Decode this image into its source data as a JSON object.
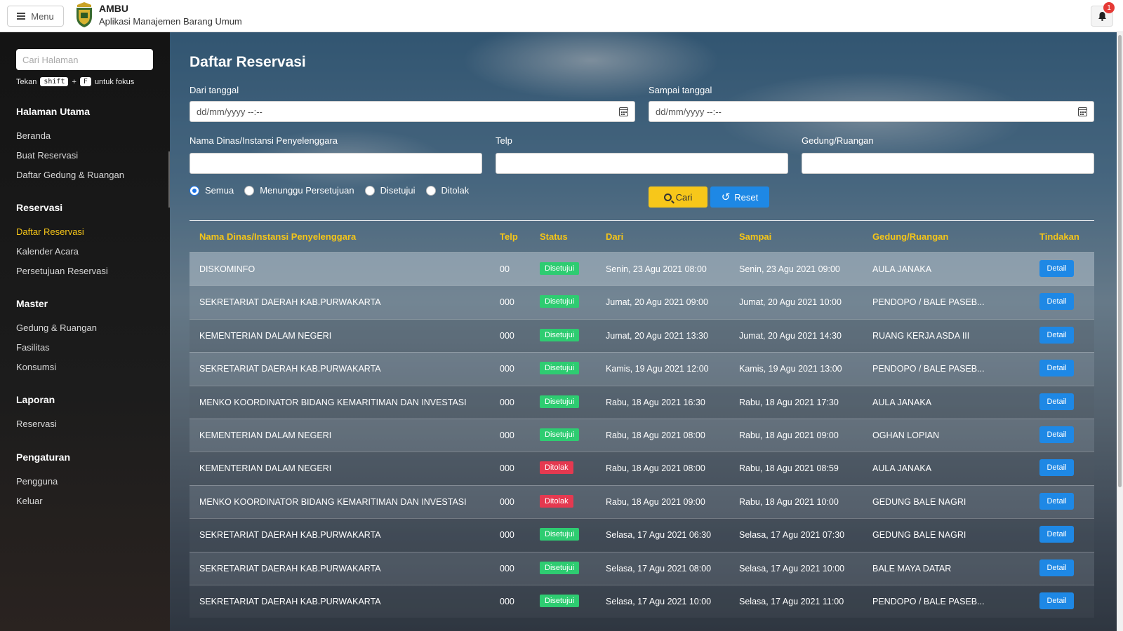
{
  "header": {
    "menu_label": "Menu",
    "app_name": "AMBU",
    "app_subtitle": "Aplikasi Manajemen Barang Umum",
    "notification_count": "1"
  },
  "sidebar": {
    "search_placeholder": "Cari Halaman",
    "hint_prefix": "Tekan",
    "hint_key1": "shift",
    "hint_plus": "+",
    "hint_key2": "F",
    "hint_suffix": "untuk fokus",
    "sections": [
      {
        "heading": "Halaman Utama",
        "items": [
          "Beranda",
          "Buat Reservasi",
          "Daftar Gedung & Ruangan"
        ]
      },
      {
        "heading": "Reservasi",
        "items": [
          "Daftar Reservasi",
          "Kalender Acara",
          "Persetujuan Reservasi"
        ]
      },
      {
        "heading": "Master",
        "items": [
          "Gedung & Ruangan",
          "Fasilitas",
          "Konsumsi"
        ]
      },
      {
        "heading": "Laporan",
        "items": [
          "Reservasi"
        ]
      },
      {
        "heading": "Pengaturan",
        "items": [
          "Pengguna",
          "Keluar"
        ]
      }
    ],
    "active_item": "Daftar Reservasi"
  },
  "main": {
    "title": "Daftar Reservasi",
    "filters": {
      "from_label": "Dari tanggal",
      "from_placeholder": "dd/mm/yyyy --:--",
      "to_label": "Sampai tanggal",
      "to_placeholder": "dd/mm/yyyy --:--",
      "org_label": "Nama Dinas/Instansi Penyelenggara",
      "phone_label": "Telp",
      "room_label": "Gedung/Ruangan",
      "radios": [
        {
          "label": "Semua",
          "checked": true
        },
        {
          "label": "Menunggu Persetujuan",
          "checked": false
        },
        {
          "label": "Disetujui",
          "checked": false
        },
        {
          "label": "Ditolak",
          "checked": false
        }
      ],
      "search_button": "Cari",
      "reset_button": "Reset"
    },
    "table": {
      "columns": [
        "Nama Dinas/Instansi Penyelenggara",
        "Telp",
        "Status",
        "Dari",
        "Sampai",
        "Gedung/Ruangan",
        "Tindakan"
      ],
      "action_label": "Detail",
      "rows": [
        {
          "org": "DISKOMINFO",
          "telp": "00",
          "status": "Disetujui",
          "from": "Senin, 23 Agu 2021 08:00",
          "to": "Senin, 23 Agu 2021 09:00",
          "room": "AULA JANAKA"
        },
        {
          "org": "SEKRETARIAT DAERAH KAB.PURWAKARTA",
          "telp": "000",
          "status": "Disetujui",
          "from": "Jumat, 20 Agu 2021 09:00",
          "to": "Jumat, 20 Agu 2021 10:00",
          "room": "PENDOPO / BALE PASEB..."
        },
        {
          "org": "KEMENTERIAN DALAM NEGERI",
          "telp": "000",
          "status": "Disetujui",
          "from": "Jumat, 20 Agu 2021 13:30",
          "to": "Jumat, 20 Agu 2021 14:30",
          "room": "RUANG KERJA ASDA III"
        },
        {
          "org": "SEKRETARIAT DAERAH KAB.PURWAKARTA",
          "telp": "000",
          "status": "Disetujui",
          "from": "Kamis, 19 Agu 2021 12:00",
          "to": "Kamis, 19 Agu 2021 13:00",
          "room": "PENDOPO / BALE PASEB..."
        },
        {
          "org": "MENKO KOORDINATOR BIDANG KEMARITIMAN DAN INVESTASI",
          "telp": "000",
          "status": "Disetujui",
          "from": "Rabu, 18 Agu 2021 16:30",
          "to": "Rabu, 18 Agu 2021 17:30",
          "room": "AULA JANAKA"
        },
        {
          "org": "KEMENTERIAN DALAM NEGERI",
          "telp": "000",
          "status": "Disetujui",
          "from": "Rabu, 18 Agu 2021 08:00",
          "to": "Rabu, 18 Agu 2021 09:00",
          "room": "OGHAN LOPIAN"
        },
        {
          "org": "KEMENTERIAN DALAM NEGERI",
          "telp": "000",
          "status": "Ditolak",
          "from": "Rabu, 18 Agu 2021 08:00",
          "to": "Rabu, 18 Agu 2021 08:59",
          "room": "AULA JANAKA"
        },
        {
          "org": "MENKO KOORDINATOR BIDANG KEMARITIMAN DAN INVESTASI",
          "telp": "000",
          "status": "Ditolak",
          "from": "Rabu, 18 Agu 2021 09:00",
          "to": "Rabu, 18 Agu 2021 10:00",
          "room": "GEDUNG BALE NAGRI"
        },
        {
          "org": "SEKRETARIAT DAERAH KAB.PURWAKARTA",
          "telp": "000",
          "status": "Disetujui",
          "from": "Selasa, 17 Agu 2021 06:30",
          "to": "Selasa, 17 Agu 2021 07:30",
          "room": "GEDUNG BALE NAGRI"
        },
        {
          "org": "SEKRETARIAT DAERAH KAB.PURWAKARTA",
          "telp": "000",
          "status": "Disetujui",
          "from": "Selasa, 17 Agu 2021 08:00",
          "to": "Selasa, 17 Agu 2021 10:00",
          "room": "BALE MAYA DATAR"
        },
        {
          "org": "SEKRETARIAT DAERAH KAB.PURWAKARTA",
          "telp": "000",
          "status": "Disetujui",
          "from": "Selasa, 17 Agu 2021 10:00",
          "to": "Selasa, 17 Agu 2021 11:00",
          "room": "PENDOPO / BALE PASEB..."
        }
      ]
    }
  },
  "colors": {
    "accent_yellow": "#f5c518",
    "primary_blue": "#1e88e5",
    "approved_green": "#2ecc71",
    "rejected_red": "#e53950"
  }
}
